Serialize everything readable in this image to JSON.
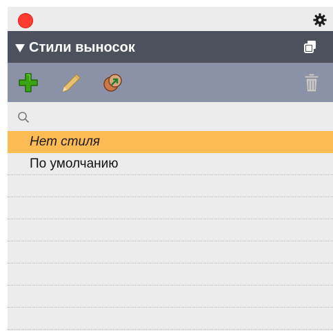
{
  "window": {
    "close_label": "close"
  },
  "header": {
    "title": "Стили выносок"
  },
  "toolbar": {
    "buttons": [
      {
        "name": "add",
        "icon": "plus-icon"
      },
      {
        "name": "edit",
        "icon": "pencil-icon"
      },
      {
        "name": "apply",
        "icon": "apply-style-icon"
      },
      {
        "name": "delete",
        "icon": "trash-icon"
      }
    ]
  },
  "search": {
    "value": "",
    "placeholder": ""
  },
  "styles": {
    "items": [
      {
        "label": "Нет стиля",
        "selected": true
      },
      {
        "label": "По умолчанию",
        "selected": false
      }
    ]
  },
  "colors": {
    "header_bg": "#4d515e",
    "toolbar_bg": "#8b92a8",
    "selection": "#fdbb54",
    "close": "#ff3b30"
  }
}
